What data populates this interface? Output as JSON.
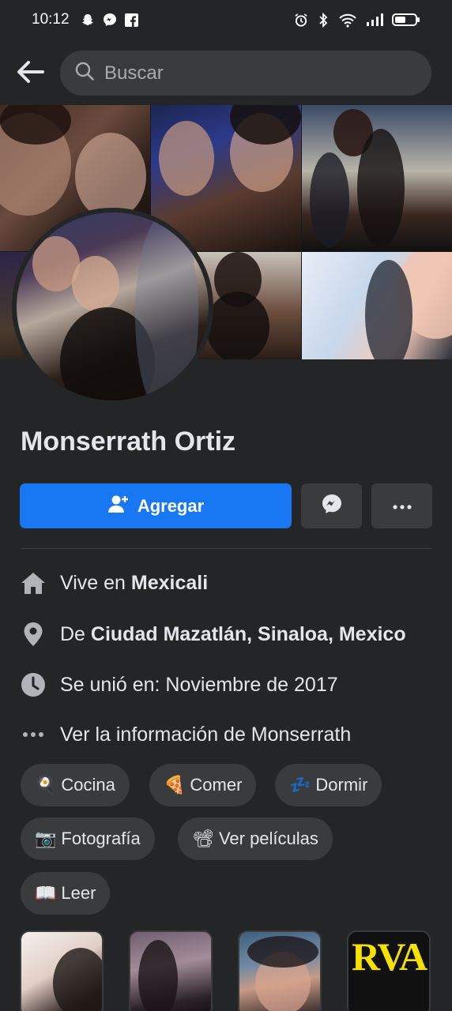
{
  "status_bar": {
    "time": "10:12",
    "left_icons": [
      "snapchat-icon",
      "messenger-icon",
      "facebook-icon"
    ],
    "right_icons": [
      "alarm-icon",
      "bluetooth-icon",
      "wifi-icon",
      "signal-icon",
      "battery-icon"
    ]
  },
  "search": {
    "placeholder": "Buscar",
    "value": ""
  },
  "profile": {
    "name": "Monserrath Ortiz"
  },
  "actions": {
    "add_label": "Agregar",
    "accent_color": "#1877f2"
  },
  "info": {
    "lives_prefix": "Vive en ",
    "lives_city": "Mexicali",
    "from_prefix": "De ",
    "from_place": "Ciudad Mazatlán, Sinaloa, Mexico",
    "joined": "Se unió en: Noviembre de 2017",
    "see_more": "Ver la información de Monserrath"
  },
  "hobbies": [
    {
      "emoji": "🍳",
      "label": "Cocina"
    },
    {
      "emoji": "🍕",
      "label": "Comer"
    },
    {
      "emoji": "💤",
      "label": "Dormir"
    },
    {
      "emoji": "📷",
      "label": "Fotografía"
    },
    {
      "emoji": "📽",
      "label": "Ver películas"
    },
    {
      "emoji": "📖",
      "label": "Leer"
    }
  ],
  "featured": {
    "thumb4_text": "RVA"
  },
  "colors": {
    "background": "#242526",
    "surface": "#3a3b3c",
    "text": "#e4e6eb"
  }
}
